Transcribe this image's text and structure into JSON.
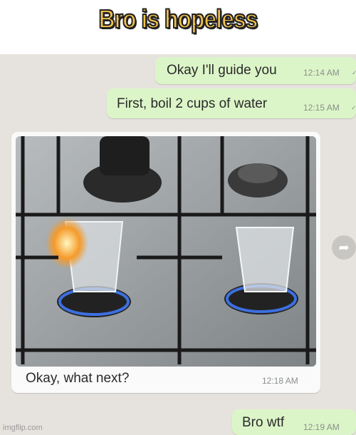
{
  "meme": {
    "title": "Bro is hopeless"
  },
  "messages": [
    {
      "text": "Okay I'll guide you",
      "time": "12:14 AM",
      "status": "✓"
    },
    {
      "text": "First, boil 2 cups of water",
      "time": "12:15 AM",
      "status": "✓"
    },
    {
      "text": "Okay, what next?",
      "time": "12:18 AM"
    },
    {
      "text": "Bro wtf",
      "time": "12:19 AM"
    }
  ],
  "icons": {
    "forward": "forward-arrow-icon"
  },
  "watermark": "imgflip.com",
  "colors": {
    "title_fill": "#f5c24a",
    "outgoing_bubble": "#dcf5c8",
    "incoming_bubble": "#fafafa",
    "chat_background": "#e6e3de"
  }
}
